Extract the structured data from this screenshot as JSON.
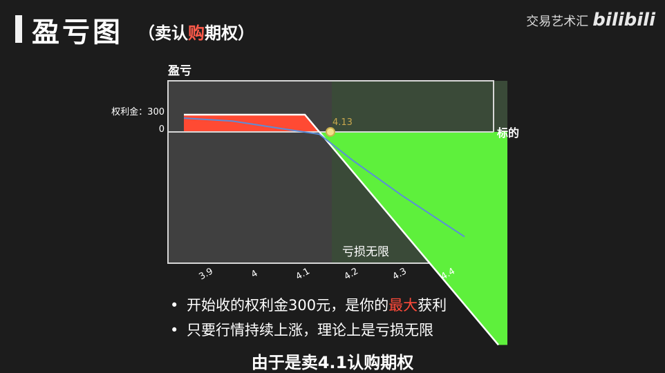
{
  "header": {
    "title": "盈亏图",
    "subtitle_prefix": "（卖认",
    "subtitle_highlight": "购",
    "subtitle_suffix": "期权）",
    "brand_text": "交易艺术汇",
    "brand_logo": "bilibili"
  },
  "chart_data": {
    "type": "line",
    "ylabel": "盈亏",
    "xlabel": "标的",
    "x_ticks": [
      "3.9",
      "4",
      "4.1",
      "4.2",
      "4.3",
      "4.4"
    ],
    "y_tick_labels": [
      "权利金：300",
      "0"
    ],
    "breakeven_label": "4.13",
    "loss_label": "亏损无限",
    "series": [
      {
        "style": "white",
        "x": [
          3.85,
          4.1,
          4.13,
          4.5
        ],
        "y": [
          300,
          300,
          0,
          -3700
        ]
      },
      {
        "style": "blue",
        "x": [
          3.85,
          3.95,
          4.05,
          4.13,
          4.2,
          4.3,
          4.43
        ],
        "y": [
          240,
          190,
          60,
          -40,
          -500,
          -1100,
          -1820
        ]
      }
    ],
    "colors": {
      "profit": "#ff4a33",
      "loss": "#5ef03c",
      "blue": "#5b8dd9",
      "otm_region": "#404040",
      "itm_region": "#3a4a38"
    }
  },
  "bullets": [
    {
      "pre": "开始收的权利金300元，是你的",
      "highlight": "最大",
      "post": "获利"
    },
    {
      "pre": "只要行情持续上涨，理论上是亏损无限",
      "highlight": "",
      "post": ""
    }
  ],
  "caption": "由于是卖4.1认购期权"
}
